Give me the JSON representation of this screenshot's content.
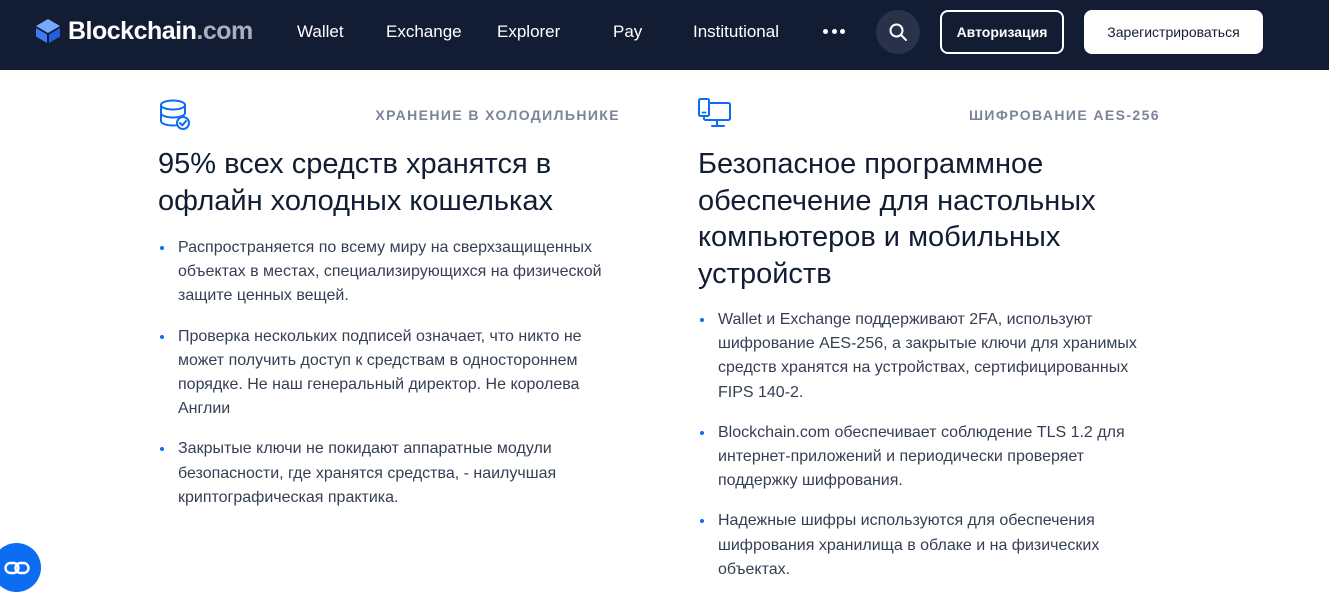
{
  "header": {
    "logo": {
      "brand": "Blockchain",
      "suffix": ".com",
      "icon": "blockchain-cube-icon"
    },
    "nav": [
      {
        "id": "wallet",
        "label": "Wallet"
      },
      {
        "id": "exchange",
        "label": "Exchange"
      },
      {
        "id": "explorer",
        "label": "Explorer"
      },
      {
        "id": "pay",
        "label": "Pay"
      },
      {
        "id": "institutional",
        "label": "Institutional"
      }
    ],
    "more_icon": "more-dots-icon",
    "search_icon": "search-icon",
    "login_label": "Авторизация",
    "signup_label": "Зарегистрироваться"
  },
  "features": [
    {
      "icon": "database-check-icon",
      "eyebrow": "ХРАНЕНИЕ В ХОЛОДИЛЬНИКЕ",
      "title": "95% всех средств хранятся в офлайн холодных кошельках",
      "bullets": [
        "Распространяется по всему миру на сверхзащищенных объектах в местах, специализирующихся на физической защите ценных вещей.",
        "Проверка нескольких подписей означает, что никто не может получить доступ к средствам в одностороннем порядке. Не наш генеральный директор. Не королева Англии",
        "Закрытые ключи не покидают аппаратные модули безопасности, где хранятся средства, - наилучшая криптографическая практика."
      ]
    },
    {
      "icon": "desktop-mobile-icon",
      "eyebrow": "ШИФРОВАНИЕ AES-256",
      "title": "Безопасное программное обеспечение для настольных компьютеров и мобильных устройств",
      "bullets": [
        "Wallet и Exchange поддерживают 2FA, используют шифрование AES-256, а закрытые ключи для хранимых средств хранятся на устройствах, сертифицированных FIPS 140-2.",
        "Blockchain.com обеспечивает соблюдение TLS 1.2 для интернет-приложений и периодически проверяет поддержку шифрования.",
        "Надежные шифры используются для обеспечения шифрования хранилища в облаке и на физических объектах."
      ]
    }
  ],
  "chat_icon": "chat-link-icon",
  "colors": {
    "nav_bg": "#121d33",
    "accent": "#0c6cf2",
    "eyebrow": "#7b849a",
    "body_text": "#353f52"
  }
}
